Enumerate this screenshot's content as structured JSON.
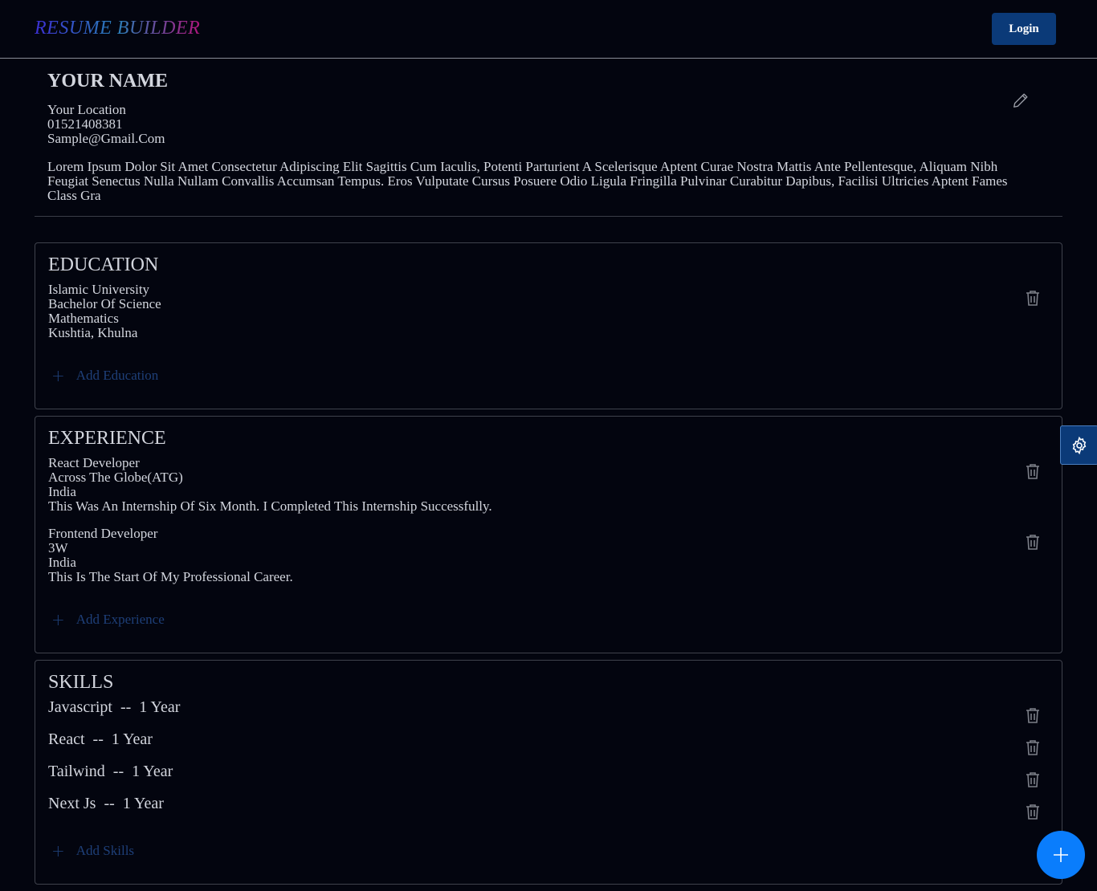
{
  "nav": {
    "brand": "RESUME BUILDER",
    "login_label": "Login"
  },
  "profile": {
    "name": "YOUR NAME",
    "location": "Your Location",
    "phone": "01521408381",
    "email": "Sample@Gmail.Com",
    "summary": "Lorem Ipsum Dolor Sit Amet Consectetur Adipiscing Elit Sagittis Cum Iaculis, Potenti Parturient A Scelerisque Aptent Curae Nostra Mattis Ante Pellentesque, Aliquam Nibh Feugiat Senectus Nulla Nullam Convallis Accumsan Tempus. Eros Vulputate Cursus Posuere Odio Ligula Fringilla Pulvinar Curabitur Dapibus, Facilisi Ultricies Aptent Fames Class Gra"
  },
  "education": {
    "title": "EDUCATION",
    "items": [
      {
        "institution": "Islamic University",
        "degree": "Bachelor Of Science",
        "subject": "Mathematics",
        "location": "Kushtia, Khulna"
      }
    ],
    "add_label": "Add Education"
  },
  "experience": {
    "title": "EXPERIENCE",
    "items": [
      {
        "role": "React Developer",
        "company": "Across The Globe(ATG)",
        "location": "India",
        "description": "This Was An Internship Of Six Month. I Completed This Internship Successfully."
      },
      {
        "role": "Frontend Developer",
        "company": "3W",
        "location": "India",
        "description": "This Is The Start Of My Professional Career."
      }
    ],
    "add_label": "Add Experience"
  },
  "skills": {
    "title": "SKILLS",
    "items": [
      {
        "label": "Javascript  --  1 Year"
      },
      {
        "label": "React  --  1 Year"
      },
      {
        "label": "Tailwind  --  1 Year"
      },
      {
        "label": "Next Js  --  1 Year"
      }
    ],
    "add_label": "Add Skills"
  },
  "icons": {
    "edit": "pencil-icon",
    "delete": "trash-icon",
    "add": "plus-icon",
    "settings": "gear-icon",
    "fab": "plus-icon"
  },
  "colors": {
    "background": "#03050f",
    "accent_button": "#0b3a78",
    "fab": "#0a7dfc",
    "add_link": "#1e3f78"
  }
}
